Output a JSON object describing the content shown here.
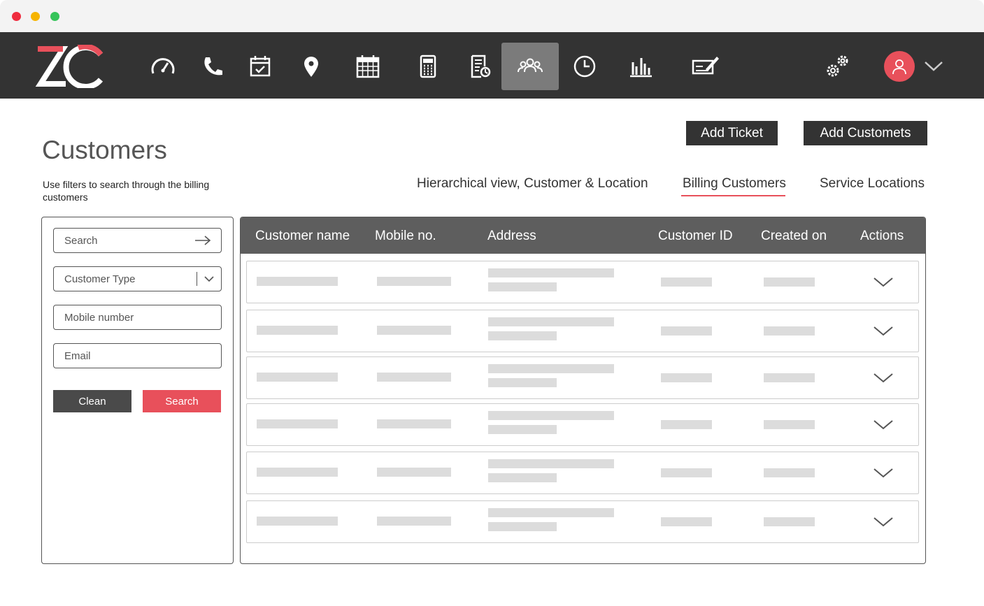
{
  "app": {
    "logo_text": "ZC"
  },
  "nav": {
    "items": [
      {
        "name": "dashboard-gauge-icon"
      },
      {
        "name": "phone-icon"
      },
      {
        "name": "calendar-check-icon"
      },
      {
        "name": "location-pin-icon"
      },
      {
        "name": "calendar-grid-icon"
      },
      {
        "name": "calculator-icon"
      },
      {
        "name": "invoice-icon"
      },
      {
        "name": "customers-group-icon",
        "active": true
      },
      {
        "name": "clock-icon"
      },
      {
        "name": "bar-chart-icon"
      },
      {
        "name": "contract-sign-icon"
      },
      {
        "name": "settings-gears-icon"
      }
    ]
  },
  "header": {
    "title": "Customers",
    "description": "Use filters to search through the billing customers",
    "add_ticket_label": "Add Ticket",
    "add_customers_label": "Add Customets"
  },
  "tabs": [
    {
      "label": "Hierarchical view, Customer & Location"
    },
    {
      "label": "Billing Customers",
      "active": true
    },
    {
      "label": "Service Locations"
    }
  ],
  "filters": {
    "search_placeholder": "Search",
    "customer_type_placeholder": "Customer Type",
    "mobile_placeholder": "Mobile number",
    "email_placeholder": "Email",
    "clean_label": "Clean",
    "search_label": "Search"
  },
  "table": {
    "columns": [
      "Customer name",
      "Mobile no.",
      "Address",
      "Customer ID",
      "Created on",
      "Actions"
    ],
    "row_count": 6
  },
  "colors": {
    "accent": "#e8505b",
    "navbar": "#333333",
    "table_header": "#5e5e5e",
    "placeholder": "#dcdcdc"
  }
}
